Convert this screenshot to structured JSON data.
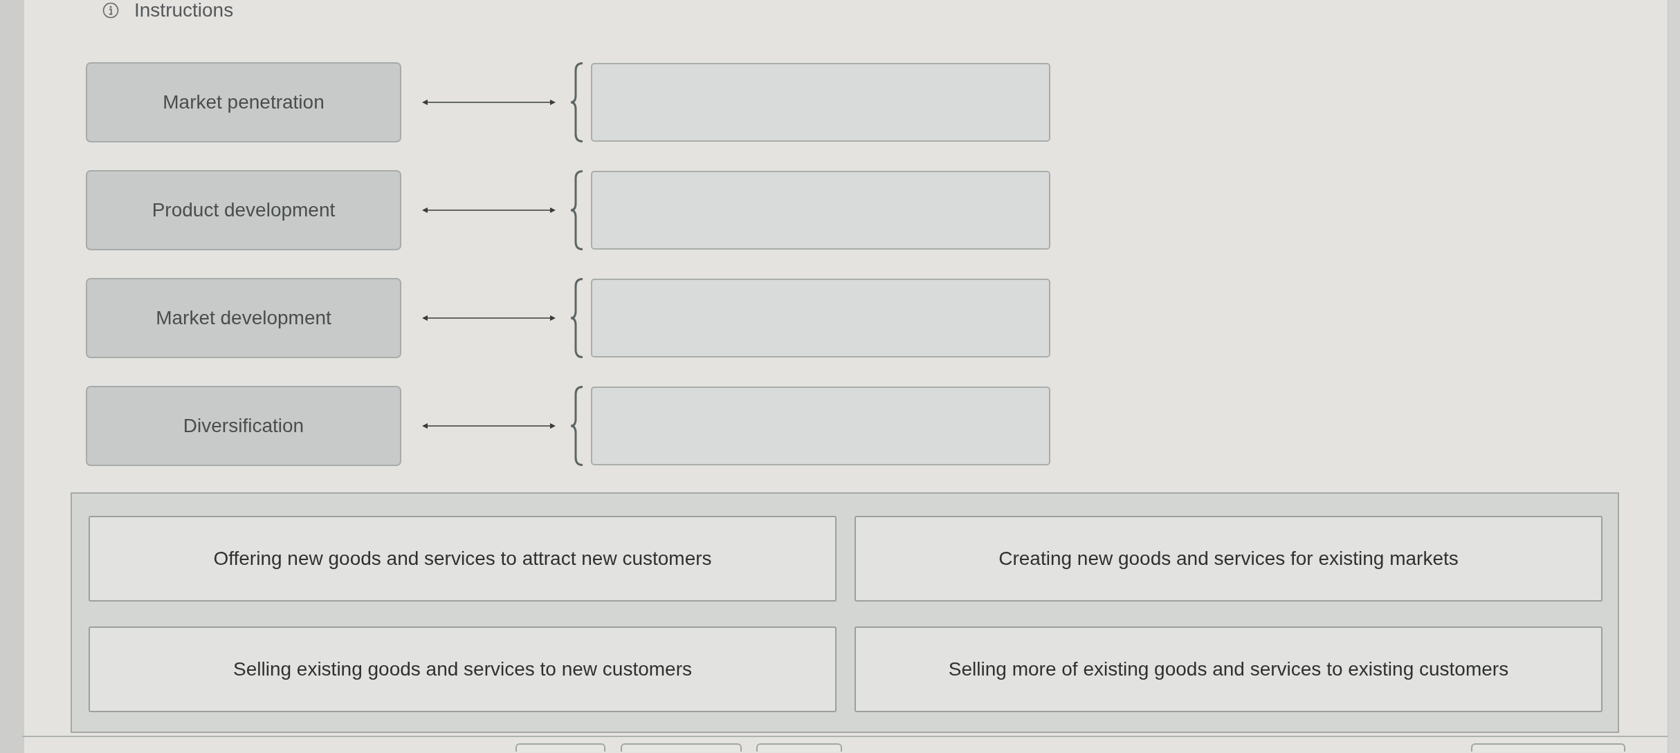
{
  "header": {
    "title": "Instructions"
  },
  "matching": {
    "terms": [
      "Market penetration",
      "Product development",
      "Market development",
      "Diversification"
    ]
  },
  "answer_bank": {
    "options": [
      "Offering new goods and services to attract new customers",
      "Creating new goods and services for existing markets",
      "Selling existing goods and services to new customers",
      "Selling more of existing goods and services to existing customers"
    ]
  }
}
